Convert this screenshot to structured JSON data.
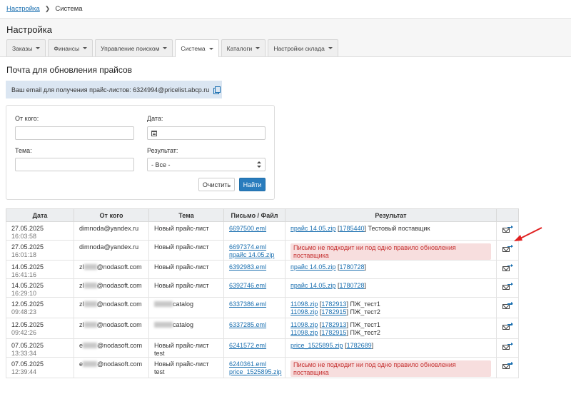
{
  "breadcrumb": {
    "parent": "Настройка",
    "current": "Система"
  },
  "page": {
    "title": "Настройка"
  },
  "tabs": [
    {
      "label": "Заказы",
      "active": false
    },
    {
      "label": "Финансы",
      "active": false
    },
    {
      "label": "Управление поиском",
      "active": false
    },
    {
      "label": "Система",
      "active": true
    },
    {
      "label": "Каталоги",
      "active": false
    },
    {
      "label": "Настройки склада",
      "active": false
    }
  ],
  "section": {
    "title": "Почта для обновления прайсов",
    "email_info": "Ваш email для получения прайс-листов: 6324994@pricelist.abcp.ru",
    "copy_icon": "copy-icon"
  },
  "filters": {
    "from_label": "От кого:",
    "from_value": "",
    "date_label": "Дата:",
    "date_value": "",
    "subject_label": "Тема:",
    "subject_value": "",
    "result_label": "Результат:",
    "result_selected": "- Все -",
    "clear_button": "Очистить",
    "find_button": "Найти"
  },
  "table": {
    "headers": [
      "Дата",
      "От кого",
      "Тема",
      "Письмо / Файл",
      "Результат",
      ""
    ],
    "rows": [
      {
        "date": "27.05.2025",
        "time": "16:03:58",
        "from": "dimnoda@yandex.ru",
        "subject": "Новый прайс-лист",
        "files": [
          "6697500.eml"
        ],
        "result_links": [
          [
            "прайс 14.05.zip",
            "1785440",
            "Тестовый поставщик"
          ]
        ],
        "error": ""
      },
      {
        "date": "27.05.2025",
        "time": "16:01:18",
        "from": "dimnoda@yandex.ru",
        "subject": "Новый прайс-лист",
        "files": [
          "6697374.eml",
          "прайс 14.05.zip"
        ],
        "result_links": [],
        "error": "Письмо не подходит ни под одно правило обновления поставщика"
      },
      {
        "date": "14.05.2025",
        "time": "16:41:16",
        "from_prefix": "zl",
        "from": "@nodasoft.com",
        "subject": "Новый прайс-лист",
        "files": [
          "6392983.eml"
        ],
        "result_links": [
          [
            "прайс 14.05.zip",
            "1780728",
            ""
          ]
        ],
        "error": ""
      },
      {
        "date": "14.05.2025",
        "time": "16:29:10",
        "from_prefix": "zl",
        "from": "@nodasoft.com",
        "subject": "Новый прайс-лист",
        "files": [
          "6392746.eml"
        ],
        "result_links": [
          [
            "прайс 14.05.zip",
            "1780728",
            ""
          ]
        ],
        "error": ""
      },
      {
        "date": "12.05.2025",
        "time": "09:48:23",
        "from_prefix": "zl",
        "from": "@nodasoft.com",
        "subject": "catalog",
        "files": [
          "6337386.eml"
        ],
        "result_links": [
          [
            "11098.zip",
            "1782913",
            "ПЖ_тест1"
          ],
          [
            "11098.zip",
            "1782915",
            "ПЖ_тест2"
          ]
        ],
        "error": ""
      },
      {
        "date": "12.05.2025",
        "time": "09:42:26",
        "from_prefix": "zl",
        "from": "@nodasoft.com",
        "subject": "catalog",
        "files": [
          "6337285.eml"
        ],
        "result_links": [
          [
            "11098.zip",
            "1782913",
            "ПЖ_тест1"
          ],
          [
            "11098.zip",
            "1782915",
            "ПЖ_тест2"
          ]
        ],
        "error": ""
      },
      {
        "date": "07.05.2025",
        "time": "13:33:34",
        "from_prefix": "e",
        "from": "@nodasoft.com",
        "subject": "Новый прайс-лист test",
        "files": [
          "6241572.eml"
        ],
        "result_links": [
          [
            "price_1525895.zip",
            "1782689",
            ""
          ]
        ],
        "error": ""
      },
      {
        "date": "07.05.2025",
        "time": "12:39:44",
        "from_prefix": "e",
        "from": "@nodasoft.com",
        "subject": "Новый прайс-лист test",
        "files": [
          "6240361.eml",
          "price_1525895.zip"
        ],
        "result_links": [],
        "error": "Письмо не подходит ни под одно правило обновления поставщика"
      }
    ],
    "action_icon": "resend-mail-icon"
  },
  "annotation_color": "#e02020"
}
